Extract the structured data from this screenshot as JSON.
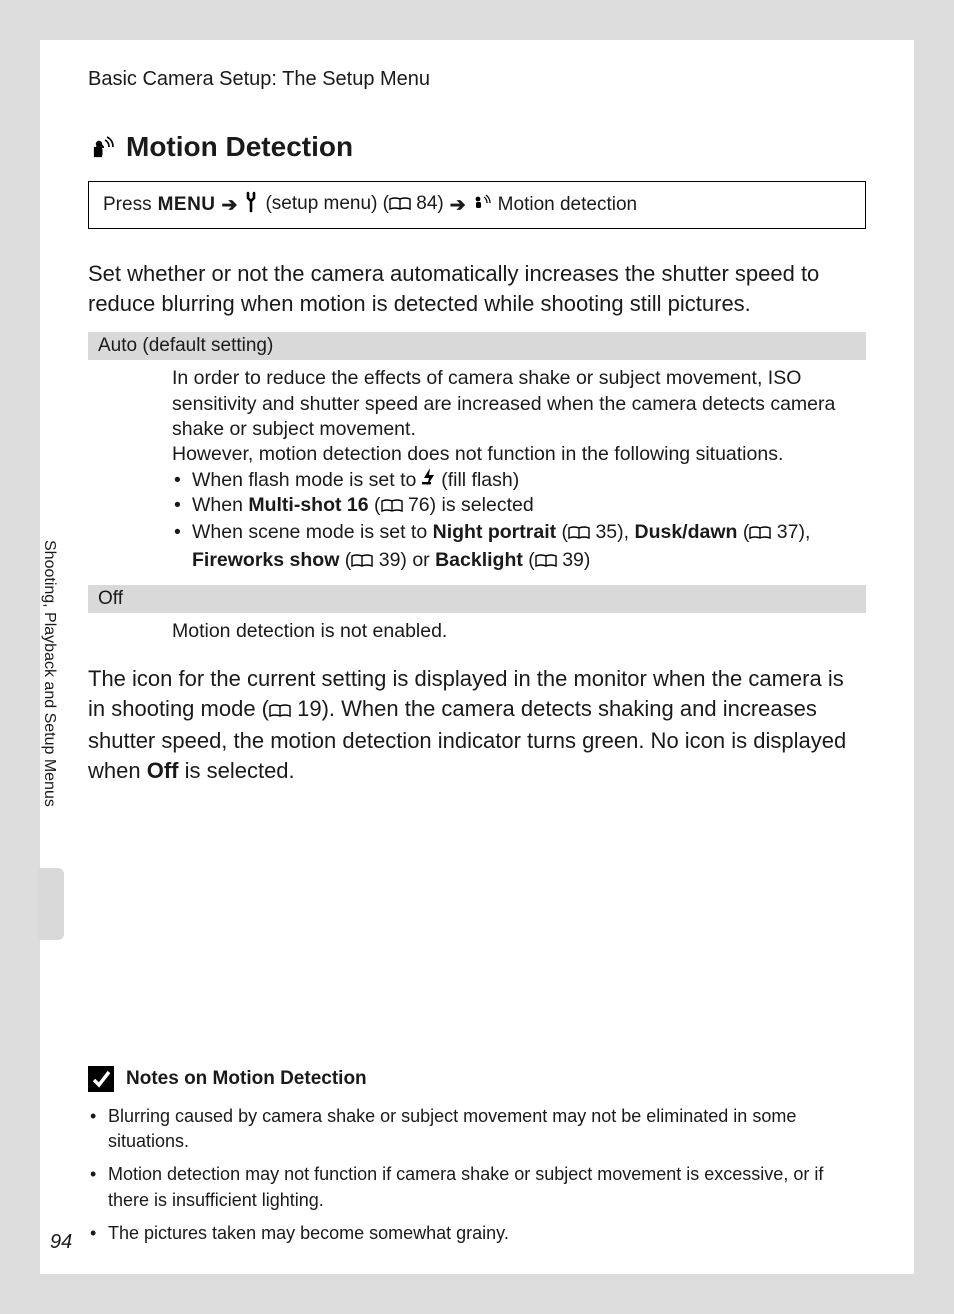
{
  "header": "Basic Camera Setup: The Setup Menu",
  "title": "Motion Detection",
  "nav": {
    "press": "Press",
    "menu": "MENU",
    "setup_menu": "(setup menu) (",
    "ref84": "84)",
    "motion_detection": "Motion detection"
  },
  "intro": "Set whether or not the camera automatically increases the shutter speed to reduce blurring when motion is detected while shooting still pictures.",
  "options": {
    "auto": {
      "label": "Auto (default setting)",
      "p1": "In order to reduce the effects of camera shake or subject movement, ISO sensitivity and shutter speed are increased when the camera detects camera shake or subject movement.",
      "p2": "However, motion detection does not function in the following situations.",
      "b1a": "When flash mode is set to ",
      "b1b": " (fill flash)",
      "b2a": "When ",
      "b2b": "Multi-shot 16",
      "b2c": " (",
      "b2d": "76) is selected",
      "b3a": "When scene mode is set to ",
      "b3b": "Night portrait",
      "b3c": " (",
      "b3d": "35), ",
      "b3e": "Dusk/dawn",
      "b3f": " (",
      "b3g": "37), ",
      "b3h": "Fireworks show",
      "b3i": " (",
      "b3j": "39) or ",
      "b3k": "Backlight",
      "b3l": " (",
      "b3m": "39)"
    },
    "off": {
      "label": "Off",
      "p1": "Motion detection is not enabled."
    }
  },
  "after": {
    "t1": "The icon for the current setting is displayed in the monitor when the camera is in shooting mode (",
    "t2": "19). When the camera detects shaking and increases shutter speed, the motion detection indicator turns green. No icon is displayed when ",
    "t3": "Off",
    "t4": " is selected."
  },
  "side_tab": "Shooting, Playback and Setup Menus",
  "notes": {
    "title": "Notes on Motion Detection",
    "items": [
      "Blurring caused by camera shake or subject movement may not be eliminated in some situations.",
      "Motion detection may not function if camera shake or subject movement is excessive, or if there is insufficient lighting.",
      "The pictures taken may become somewhat grainy."
    ]
  },
  "page_number": "94"
}
